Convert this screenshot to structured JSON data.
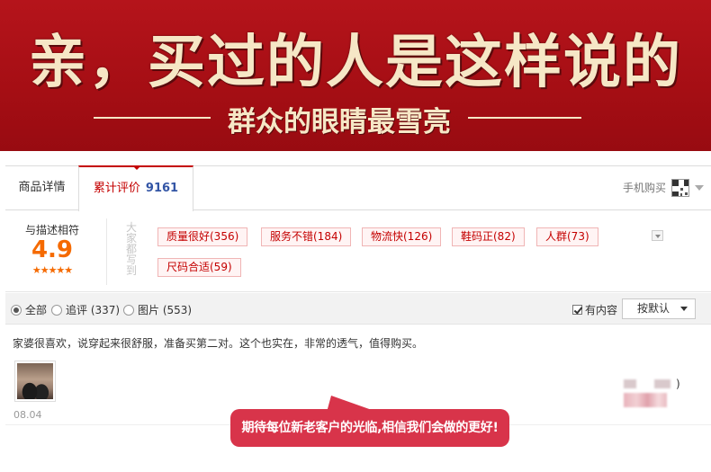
{
  "banner": {
    "title": "亲，买过的人是这样说的",
    "subtitle": "群众的眼睛最雪亮"
  },
  "tabs": {
    "details_label": "商品详情",
    "reviews_label": "累计评价",
    "reviews_count": "9161",
    "mobile_buy_label": "手机购买"
  },
  "rating": {
    "label": "与描述相符",
    "score": "4.9",
    "stars": "★★★★★",
    "vertical_hint": "大家都写到"
  },
  "tags": [
    "质量很好(356)",
    "服务不错(184)",
    "物流快(126)",
    "鞋码正(82)",
    "人群(73)",
    "尺码合适(59)"
  ],
  "filters": {
    "all_label": "全部",
    "followup_label": "追评 (337)",
    "pictures_label": "图片 (553)",
    "has_content_label": "有内容",
    "sort_label": "按默认"
  },
  "review": {
    "text": "家婆很喜欢，说穿起来很舒服，准备买第二对。这个也实在，非常的透气，值得购买。",
    "date": "08.04",
    "reviewer_suffix": ")"
  },
  "promo": {
    "text": "期待每位新老客户的光临,相信我们会做的更好!"
  },
  "colors": {
    "banner_red": "#a50e14",
    "banner_text": "#f6e7c6",
    "accent_red": "#c40000",
    "score_orange": "#f56a00",
    "count_blue": "#3355a5",
    "promo_red": "#d8344a"
  }
}
